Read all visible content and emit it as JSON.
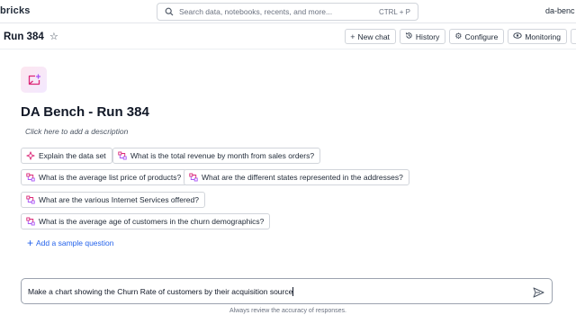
{
  "topbar": {
    "brand": "bricks",
    "search_placeholder": "Search data, notebooks, recents, and more...",
    "search_shortcut": "CTRL + P",
    "workspace": "da-benc"
  },
  "header": {
    "title": "Run 384",
    "actions": {
      "new_chat": "New chat",
      "history": "History",
      "configure": "Configure",
      "monitoring": "Monitoring"
    }
  },
  "space": {
    "title": "DA Bench - Run 384",
    "description_placeholder": "Click here to add a description"
  },
  "samples": {
    "explain": "Explain the data set",
    "q1": "What is the total revenue by month from sales orders?",
    "q2": "What is the average list price of products?",
    "q3": "What are the different states represented in the addresses?",
    "q4": "What are the various Internet Services offered?",
    "q5": "What is the average age of customers in the churn demographics?",
    "add_label": "Add a sample question"
  },
  "composer": {
    "value": "Make a chart showing the Churn Rate of customers by their acquisition source",
    "disclaimer": "Always review the accuracy of responses."
  },
  "colors": {
    "accent": "#2563eb",
    "border": "#d1d5db",
    "icon_pink": "#db2777",
    "icon_purple": "#a855f7"
  },
  "icons": [
    "search-icon",
    "star-icon",
    "plus-icon",
    "history-icon",
    "gear-icon",
    "monitor-icon",
    "sparkle-icon",
    "sample-query-icon",
    "send-icon"
  ]
}
